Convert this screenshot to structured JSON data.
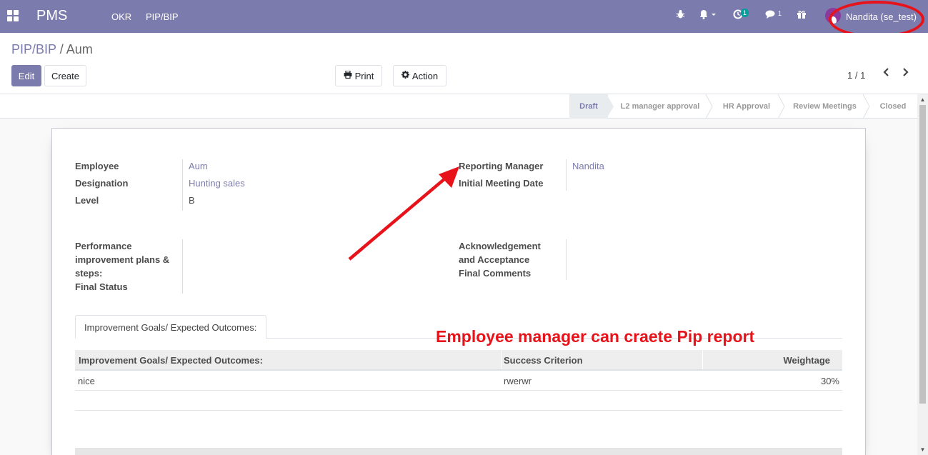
{
  "nav": {
    "brand": "PMS",
    "menu": [
      "OKR",
      "PIP/BIP"
    ],
    "activity_count": "1",
    "messages_count": "1",
    "user": "Nandita (se_test)"
  },
  "breadcrumb": {
    "parent": "PIP/BIP",
    "separator": "/",
    "current": "Aum"
  },
  "buttons": {
    "edit": "Edit",
    "create": "Create",
    "print": "Print",
    "action": "Action"
  },
  "pager": {
    "value": "1 / 1"
  },
  "stages": [
    {
      "label": "Draft",
      "active": true
    },
    {
      "label": "L2 manager approval",
      "active": false
    },
    {
      "label": "HR Approval",
      "active": false
    },
    {
      "label": "Review Meetings",
      "active": false
    },
    {
      "label": "Closed",
      "active": false
    }
  ],
  "form": {
    "employee_label": "Employee",
    "employee_value": "Aum",
    "designation_label": "Designation",
    "designation_value": "Hunting sales",
    "level_label": "Level",
    "level_value": "B",
    "reporting_manager_label": "Reporting Manager",
    "reporting_manager_value": "Nandita",
    "initial_meeting_label": "Initial Meeting Date",
    "perf_plan_label_1": "Performance",
    "perf_plan_label_2": "improvement plans &",
    "perf_plan_label_3": "steps:",
    "final_status_label": "Final Status",
    "ack_label_1": "Acknowledgement",
    "ack_label_2": "and Acceptance",
    "final_comments_label": "Final Comments"
  },
  "tab": {
    "label": "Improvement Goals/ Expected Outcomes:"
  },
  "table": {
    "headers": [
      "Improvement Goals/ Expected Outcomes:",
      "Success Criterion",
      "Weightage"
    ],
    "rows": [
      {
        "goal": "nice",
        "criterion": "rwerwr",
        "weightage": "30%"
      }
    ]
  },
  "annotation": {
    "text": "Employee manager can craete Pip report",
    "color": "#e8131a"
  },
  "colors": {
    "primary": "#7c7bad",
    "annotation": "#e8131a",
    "stage_active_bg": "#e9ecef"
  }
}
